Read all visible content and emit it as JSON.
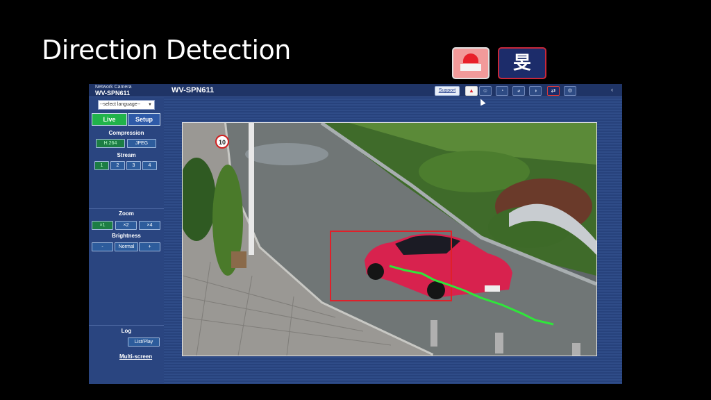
{
  "slide": {
    "title": "Direction Detection",
    "big_icons": [
      "alarm-icon",
      "direction-detection-icon"
    ],
    "direction_glyph": "旻"
  },
  "header": {
    "brand_line": "Network Camera",
    "brand_model": "WV-SPN611",
    "title": "WV-SPN611",
    "support_label": "Support",
    "toolbar_icons": [
      "alarm-icon",
      "person-detection-icon",
      "bicycle-detection-icon",
      "motorcycle-detection-icon",
      "car-detection-icon",
      "direction-detection-icon",
      "settings-icon"
    ],
    "collapse_glyph": "‹"
  },
  "sidebar": {
    "language_placeholder": "--select language--",
    "live_label": "Live",
    "setup_label": "Setup",
    "compression": {
      "label": "Compression",
      "options": [
        "H.264",
        "JPEG"
      ],
      "selected": "H.264"
    },
    "stream": {
      "label": "Stream",
      "options": [
        "1",
        "2",
        "3",
        "4"
      ],
      "selected": "1"
    },
    "zoom": {
      "label": "Zoom",
      "options": [
        "×1",
        "×2",
        "×4"
      ],
      "selected": "×1"
    },
    "brightness": {
      "label": "Brightness",
      "minus": "-",
      "normal": "Normal",
      "plus": "+"
    },
    "log": {
      "label": "Log",
      "button": "List/Play"
    },
    "multiscreen": "Multi-screen"
  },
  "video": {
    "sign_text": "10",
    "bbox_color": "#e0202a",
    "track_color": "#2fe63a",
    "car_color": "#d8224e"
  },
  "colors": {
    "accent_green": "#21b34a",
    "panel_blue": "#26417a",
    "alarm_red": "#e8202a"
  }
}
